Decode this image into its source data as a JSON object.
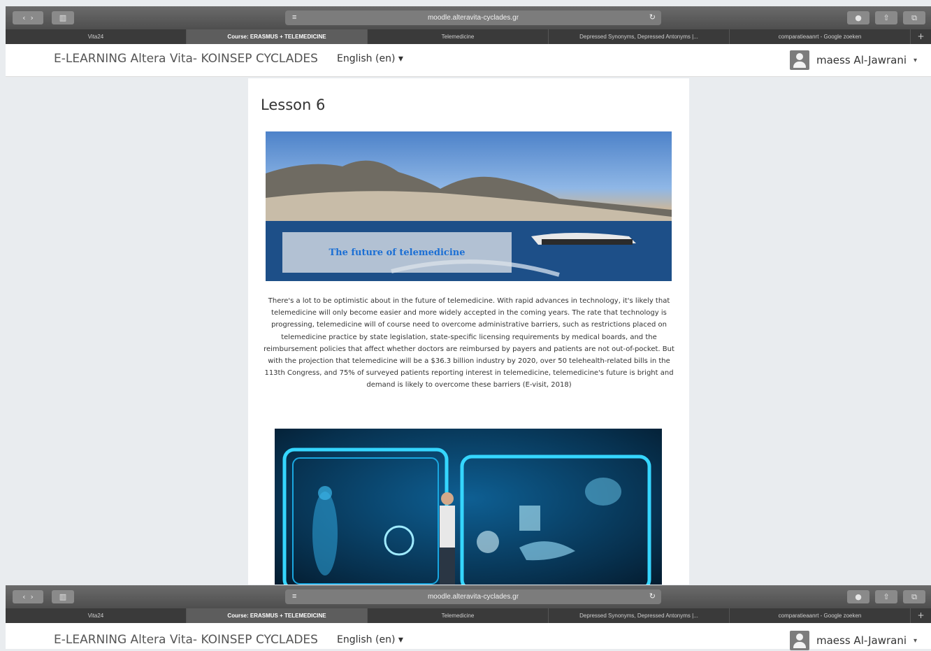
{
  "browser": {
    "url": "moodle.alteravita-cyclades.gr",
    "tabs": [
      {
        "label": "Vita24",
        "active": false
      },
      {
        "label": "Course: ERASMUS + TELEMEDICINE",
        "active": true
      },
      {
        "label": "Telemedicine",
        "active": false
      },
      {
        "label": "Depressed Synonyms, Depressed Antonyms |...",
        "active": false
      },
      {
        "label": "comparatieaanrt - Google zoeken",
        "active": false
      }
    ],
    "new_tab": "+"
  },
  "navbar": {
    "site_name": "E-LEARNING Altera Vita- KOINSEP CYCLADES",
    "language": "English (en) ▾",
    "user_name": "maess Al-Jawrani",
    "user_caret": "▾"
  },
  "lesson": {
    "title": "Lesson 6",
    "hero_caption": "The future of telemedicine",
    "paragraph": "There's a lot to be optimistic about in the future of telemedicine. With rapid advances in technology, it's likely that telemedicine will only become easier and more widely accepted in the coming years. The rate that technology is progressing, telemedicine will of course need to overcome administrative barriers, such as restrictions placed on telemedicine practice by state legislation, state-specific licensing requirements by medical boards, and the reimbursement policies that affect whether doctors are reimbursed by payers and patients are not out-of-pocket. But with the projection that telemedicine will be a $36.3 billion industry by 2020, over 50 telehealth-related bills in the 113th Congress, and 75% of surveyed patients reporting interest in telemedicine, telemedicine's future is bright and demand is likely to overcome these barriers (E-visit, 2018)"
  },
  "icons": [
    "back-icon",
    "forward-icon",
    "sidebar-icon",
    "reader-icon",
    "reload-icon",
    "download-icon",
    "share-icon",
    "tabs-icon",
    "avatar-icon"
  ],
  "colors": {
    "caption": "#1b6fd4",
    "toolbar": "#5b5b5b",
    "tabbar": "#3a3a3a",
    "page_bg": "#e9ecef"
  }
}
